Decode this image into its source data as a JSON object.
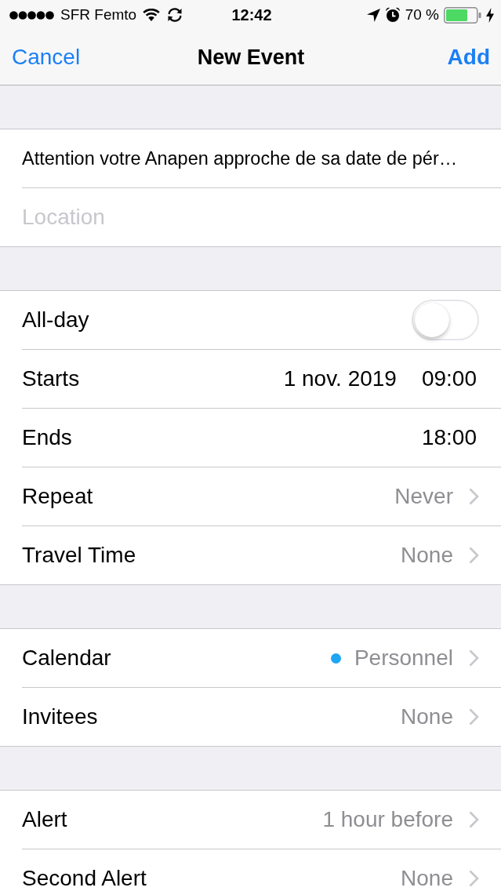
{
  "status_bar": {
    "carrier": "SFR Femto",
    "time": "12:42",
    "battery": "70 %"
  },
  "nav_bar": {
    "cancel": "Cancel",
    "title": "New Event",
    "add": "Add"
  },
  "sections": [
    {
      "rows": [
        {
          "kind": "text_field",
          "value": "Attention votre Anapen approche de sa date de pér…"
        },
        {
          "kind": "text_field",
          "placeholder": "Location"
        }
      ]
    },
    {
      "rows": [
        {
          "kind": "toggle",
          "label": "All-day",
          "on": false
        },
        {
          "kind": "datetime",
          "label": "Starts",
          "date": "1 nov. 2019",
          "time": "09:00"
        },
        {
          "kind": "datetime",
          "label": "Ends",
          "time": "18:00"
        },
        {
          "kind": "disclosure",
          "label": "Repeat",
          "value": "Never"
        },
        {
          "kind": "disclosure",
          "label": "Travel Time",
          "value": "None"
        }
      ]
    },
    {
      "rows": [
        {
          "kind": "disclosure",
          "label": "Calendar",
          "value": "Personnel",
          "color": "#1ea5f4"
        },
        {
          "kind": "disclosure",
          "label": "Invitees",
          "value": "None"
        }
      ]
    },
    {
      "rows": [
        {
          "kind": "disclosure",
          "label": "Alert",
          "value": "1 hour before"
        },
        {
          "kind": "disclosure",
          "label": "Second Alert",
          "value": "None"
        }
      ]
    }
  ]
}
